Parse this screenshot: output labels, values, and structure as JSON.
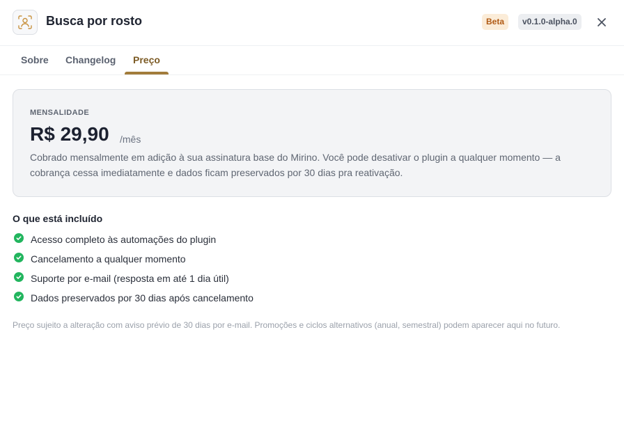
{
  "header": {
    "icon": "face-scan-icon",
    "title": "Busca por rosto",
    "beta_badge": "Beta",
    "version_badge": "v0.1.0-alpha.0",
    "close_icon": "close-icon"
  },
  "tabs": [
    {
      "label": "Sobre",
      "active": false
    },
    {
      "label": "Changelog",
      "active": false
    },
    {
      "label": "Preço",
      "active": true
    }
  ],
  "pricing": {
    "label": "MENSALIDADE",
    "amount": "R$ 29,90",
    "period": "/mês",
    "description": "Cobrado mensalmente em adição à sua assinatura base do Mirino. Você pode desativar o plugin a qualquer momento — a cobrança cessa imediatamente e dados ficam preservados por 30 dias pra reativação."
  },
  "included": {
    "title": "O que está incluído",
    "items": [
      "Acesso completo às automações do plugin",
      "Cancelamento a qualquer momento",
      "Suporte por e-mail (resposta em até 1 dia útil)",
      "Dados preservados por 30 dias após cancelamento"
    ]
  },
  "footnote": "Preço sujeito a alteração com aviso prévio de 30 dias por e-mail. Promoções e ciclos alternativos (anual, semestral) podem aparecer aqui no futuro.",
  "colors": {
    "accent": "#a27c3b",
    "beta_bg": "#fbecd8",
    "beta_text": "#b05a14",
    "check": "#22b55e"
  }
}
